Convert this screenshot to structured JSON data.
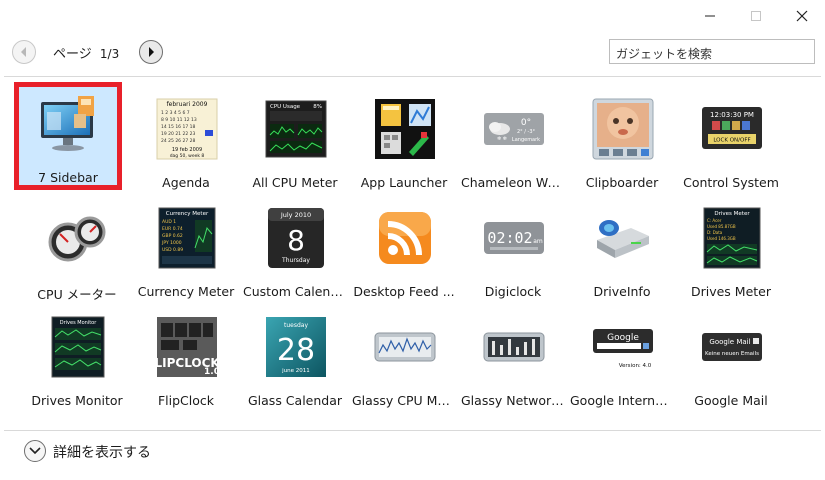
{
  "header": {
    "page_prefix": "ページ",
    "page_number": "1/3",
    "search_placeholder": "ガジェットを検索"
  },
  "gadgets": [
    {
      "label": "7 Sidebar",
      "icon": "monitor-icon",
      "selected": true
    },
    {
      "label": "Agenda",
      "icon": "calendar-icon"
    },
    {
      "label": "All CPU Meter",
      "icon": "cpu-meter-icon"
    },
    {
      "label": "App Launcher",
      "icon": "app-launcher-icon"
    },
    {
      "label": "Chameleon We...",
      "icon": "weather-icon"
    },
    {
      "label": "Clipboarder",
      "icon": "clipboard-icon"
    },
    {
      "label": "Control System",
      "icon": "control-system-icon"
    },
    {
      "label": "CPU メーター",
      "icon": "gauge-icon"
    },
    {
      "label": "Currency Meter",
      "icon": "currency-meter-icon"
    },
    {
      "label": "Custom Calend...",
      "icon": "calendar-8-icon"
    },
    {
      "label": "Desktop Feed ...",
      "icon": "rss-icon"
    },
    {
      "label": "Digiclock",
      "icon": "digital-clock-icon"
    },
    {
      "label": "DriveInfo",
      "icon": "drive-icon"
    },
    {
      "label": "Drives Meter",
      "icon": "drives-meter-icon"
    },
    {
      "label": "Drives Monitor",
      "icon": "drives-monitor-icon"
    },
    {
      "label": "FlipClock",
      "icon": "flip-clock-icon"
    },
    {
      "label": "Glass Calendar",
      "icon": "glass-calendar-icon"
    },
    {
      "label": "Glassy CPU Mo...",
      "icon": "glassy-cpu-icon"
    },
    {
      "label": "Glassy Network...",
      "icon": "glassy-network-icon"
    },
    {
      "label": "Google Interna...",
      "icon": "google-search-icon"
    },
    {
      "label": "Google Mail",
      "icon": "google-mail-icon"
    }
  ],
  "icon_text": {
    "agenda_month": "februari 2009",
    "agenda_date": "19 feb 2009",
    "agenda_week": "dag 50, week 8",
    "cpu_title": "CPU Usage",
    "cpu_pct": "8%",
    "chameleon_temp": "0°",
    "chameleon_range": "2° / -3°",
    "chameleon_city": "Langemark",
    "control_time": "12:03:30 PM",
    "control_lock": "LOCK ON/OFF",
    "currency_title": "Currency Meter",
    "custom_cal_month": "July 2010",
    "custom_cal_day": "8",
    "custom_cal_weekday": "Thursday",
    "digiclock_time": "02:02",
    "digiclock_ampm": "am",
    "drives_meter_title": "Drives Meter",
    "drives_monitor_title": "Drives Monitor",
    "flipclock_word": "FLIPCLOCK",
    "flipclock_version": "1.0",
    "glass_cal_weekday": "tuesday",
    "glass_cal_day": "28",
    "glass_cal_month": "june 2011",
    "google_logo": "Google",
    "google_version": "Version: 4.0",
    "gmail_title": "Google Mail",
    "gmail_sub": "Keine neuen Emails"
  },
  "footer": {
    "details_label": "詳細を表示する"
  }
}
